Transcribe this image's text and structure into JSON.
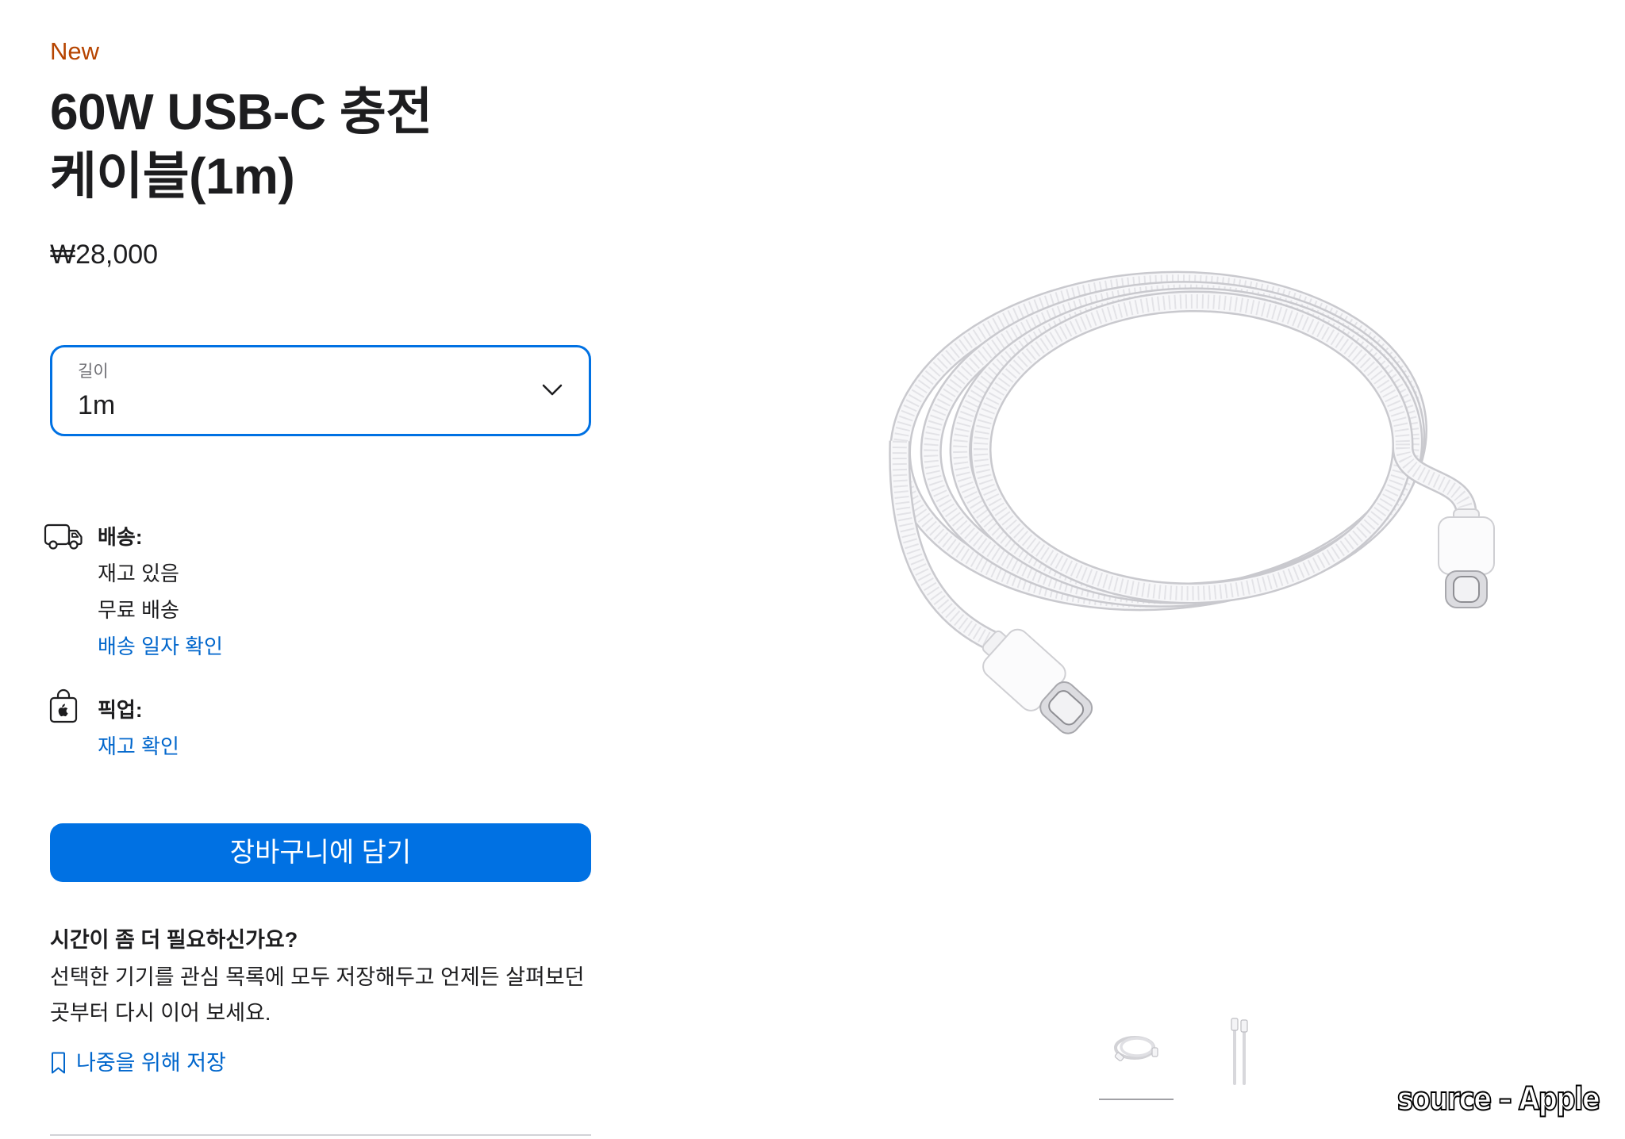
{
  "product": {
    "badge": "New",
    "title_lines": [
      "60W USB-C 충전",
      "케이블(1m)"
    ],
    "price": "₩28,000"
  },
  "length_select": {
    "label": "길이",
    "value": "1m"
  },
  "delivery": {
    "heading": "배송:",
    "stock": "재고 있음",
    "shipping": "무료 배송",
    "link": "배송 일자 확인"
  },
  "pickup": {
    "heading": "픽업:",
    "link": "재고 확인"
  },
  "cart_button": "장바구니에 담기",
  "save_later": {
    "heading": "시간이 좀 더 필요하신가요?",
    "body_lines": [
      "선택한 기기를 관심 목록에 모두 저장해두고 언제든 살펴보던",
      "곳부터 다시 이어 보세요."
    ],
    "link": "나중을 위해 저장"
  },
  "gallery": {
    "thumbnails": [
      {
        "icon": "coiled-cable-thumbnail",
        "selected": true
      },
      {
        "icon": "straight-cables-thumbnail",
        "selected": false
      }
    ]
  },
  "watermark": "source – Apple",
  "icons": {
    "delivery": "truck-icon",
    "pickup": "apple-store-bag-icon",
    "select_arrow": "chevron-down-icon",
    "save": "bookmark-icon"
  },
  "colors": {
    "accent": "#0071e3",
    "link": "#0066cc",
    "badge": "#b64400",
    "text": "#1d1d1f"
  }
}
